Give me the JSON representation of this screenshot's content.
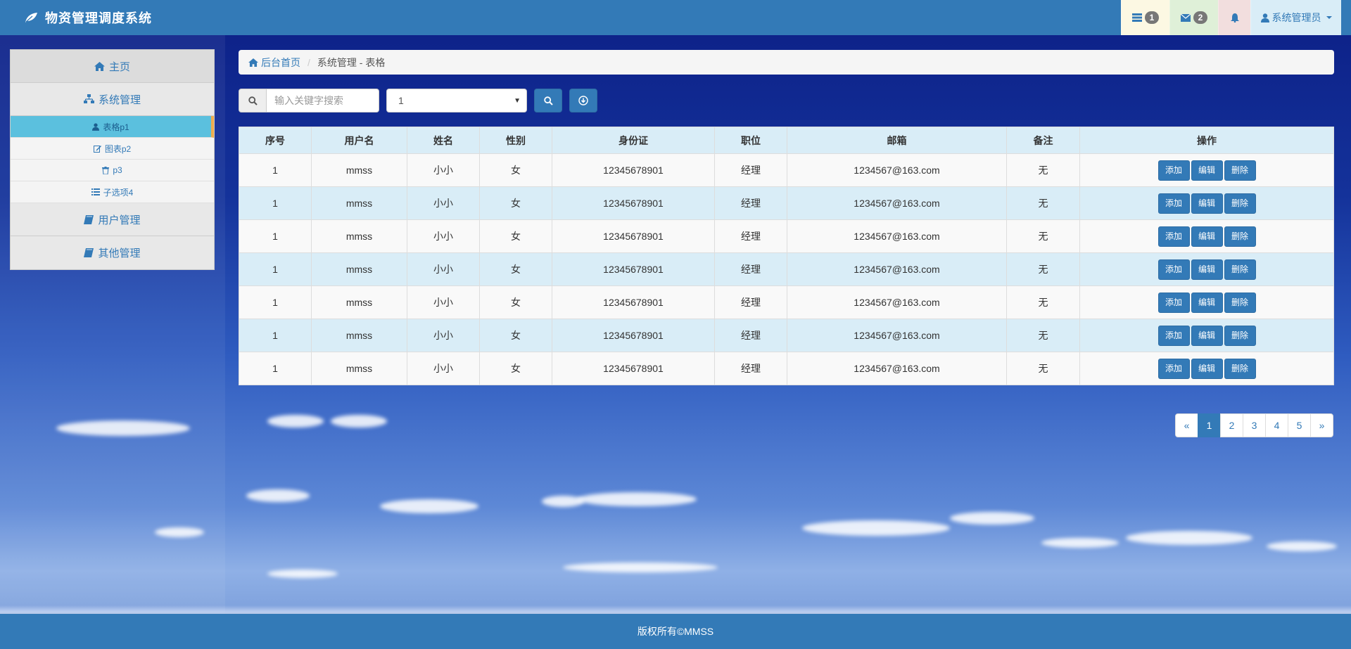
{
  "app": {
    "title": "物资管理调度系统",
    "brand_icon": "leaf-icon"
  },
  "navbar": {
    "tasks": {
      "icon": "tasks-icon",
      "count": "1"
    },
    "messages": {
      "icon": "envelope-icon",
      "count": "2"
    },
    "alerts": {
      "icon": "bell-icon"
    },
    "user": {
      "icon": "user-icon",
      "label": "系统管理员"
    },
    "colors": {
      "bar": "#337ab7",
      "tasks_bg": "#fcf8e3",
      "msgs_bg": "#dff0d8",
      "alerts_bg": "#f2dede",
      "user_bg": "#d9edf7"
    }
  },
  "sidebar": {
    "home": {
      "label": "主页",
      "icon": "home-icon"
    },
    "system": {
      "label": "系统管理",
      "icon": "sitemap-icon"
    },
    "sub_items": [
      {
        "label": "表格p1",
        "icon": "user-icon",
        "active": true
      },
      {
        "label": "图表p2",
        "icon": "edit-icon",
        "active": false
      },
      {
        "label": "p3",
        "icon": "trash-icon",
        "active": false
      },
      {
        "label": "子选项4",
        "icon": "list-icon",
        "active": false
      }
    ],
    "users": {
      "label": "用户管理",
      "icon": "book-icon"
    },
    "other": {
      "label": "其他管理",
      "icon": "book-icon"
    }
  },
  "breadcrumb": {
    "home_label": "后台首页",
    "current": "系统管理 - 表格"
  },
  "toolbar": {
    "search_placeholder": "输入关键字搜索",
    "select_value": "1"
  },
  "table": {
    "headers": [
      "序号",
      "用户名",
      "姓名",
      "性别",
      "身份证",
      "职位",
      "邮箱",
      "备注",
      "操作"
    ],
    "rows": [
      [
        "1",
        "mmss",
        "小小",
        "女",
        "12345678901",
        "经理",
        "1234567@163.com",
        "无"
      ],
      [
        "1",
        "mmss",
        "小小",
        "女",
        "12345678901",
        "经理",
        "1234567@163.com",
        "无"
      ],
      [
        "1",
        "mmss",
        "小小",
        "女",
        "12345678901",
        "经理",
        "1234567@163.com",
        "无"
      ],
      [
        "1",
        "mmss",
        "小小",
        "女",
        "12345678901",
        "经理",
        "1234567@163.com",
        "无"
      ],
      [
        "1",
        "mmss",
        "小小",
        "女",
        "12345678901",
        "经理",
        "1234567@163.com",
        "无"
      ],
      [
        "1",
        "mmss",
        "小小",
        "女",
        "12345678901",
        "经理",
        "1234567@163.com",
        "无"
      ],
      [
        "1",
        "mmss",
        "小小",
        "女",
        "12345678901",
        "经理",
        "1234567@163.com",
        "无"
      ]
    ],
    "actions": {
      "add": "添加",
      "edit": "编辑",
      "delete": "删除"
    }
  },
  "pagination": {
    "prev": "«",
    "pages": [
      "1",
      "2",
      "3",
      "4",
      "5"
    ],
    "active": "1",
    "next": "»"
  },
  "footer": {
    "text": "版权所有©MMSS"
  }
}
